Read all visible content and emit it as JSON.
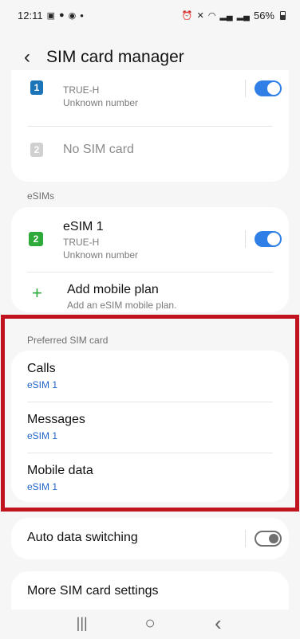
{
  "status_bar": {
    "time": "12:11",
    "notification_icons": [
      "gallery-icon",
      "chat-icon",
      "messenger-icon"
    ],
    "dot": "•",
    "battery": "56%"
  },
  "header": {
    "back_icon": "chevron-left-icon",
    "title": "SIM card manager"
  },
  "sim_cards": [
    {
      "slot": "1",
      "carrier": "TRUE-H",
      "number": "Unknown number",
      "enabled": true
    },
    {
      "slot": "2",
      "label": "No SIM card"
    }
  ],
  "esims": {
    "section_label": "eSIMs",
    "items": [
      {
        "slot": "2",
        "name": "eSIM 1",
        "carrier": "TRUE-H",
        "number": "Unknown number",
        "enabled": true
      }
    ],
    "add_plan": {
      "title": "Add mobile plan",
      "subtitle": "Add an eSIM mobile plan."
    }
  },
  "preferred": {
    "section_label": "Preferred SIM card",
    "items": [
      {
        "label": "Calls",
        "value": "eSIM 1"
      },
      {
        "label": "Messages",
        "value": "eSIM 1"
      },
      {
        "label": "Mobile data",
        "value": "eSIM 1"
      }
    ]
  },
  "auto_data_switching": {
    "label": "Auto data switching",
    "enabled": false
  },
  "more_settings": {
    "label": "More SIM card settings"
  },
  "nav": {
    "recents": "|||",
    "home": "○",
    "back": "‹"
  },
  "colors": {
    "accent_blue": "#2f7fe6",
    "sim1_badge": "#1b73b8",
    "sim2_badge_disabled": "#d0d0d0",
    "esim_badge": "#2eaa3a",
    "add_plus": "#2eaa3a",
    "highlight": "#c1121f"
  }
}
